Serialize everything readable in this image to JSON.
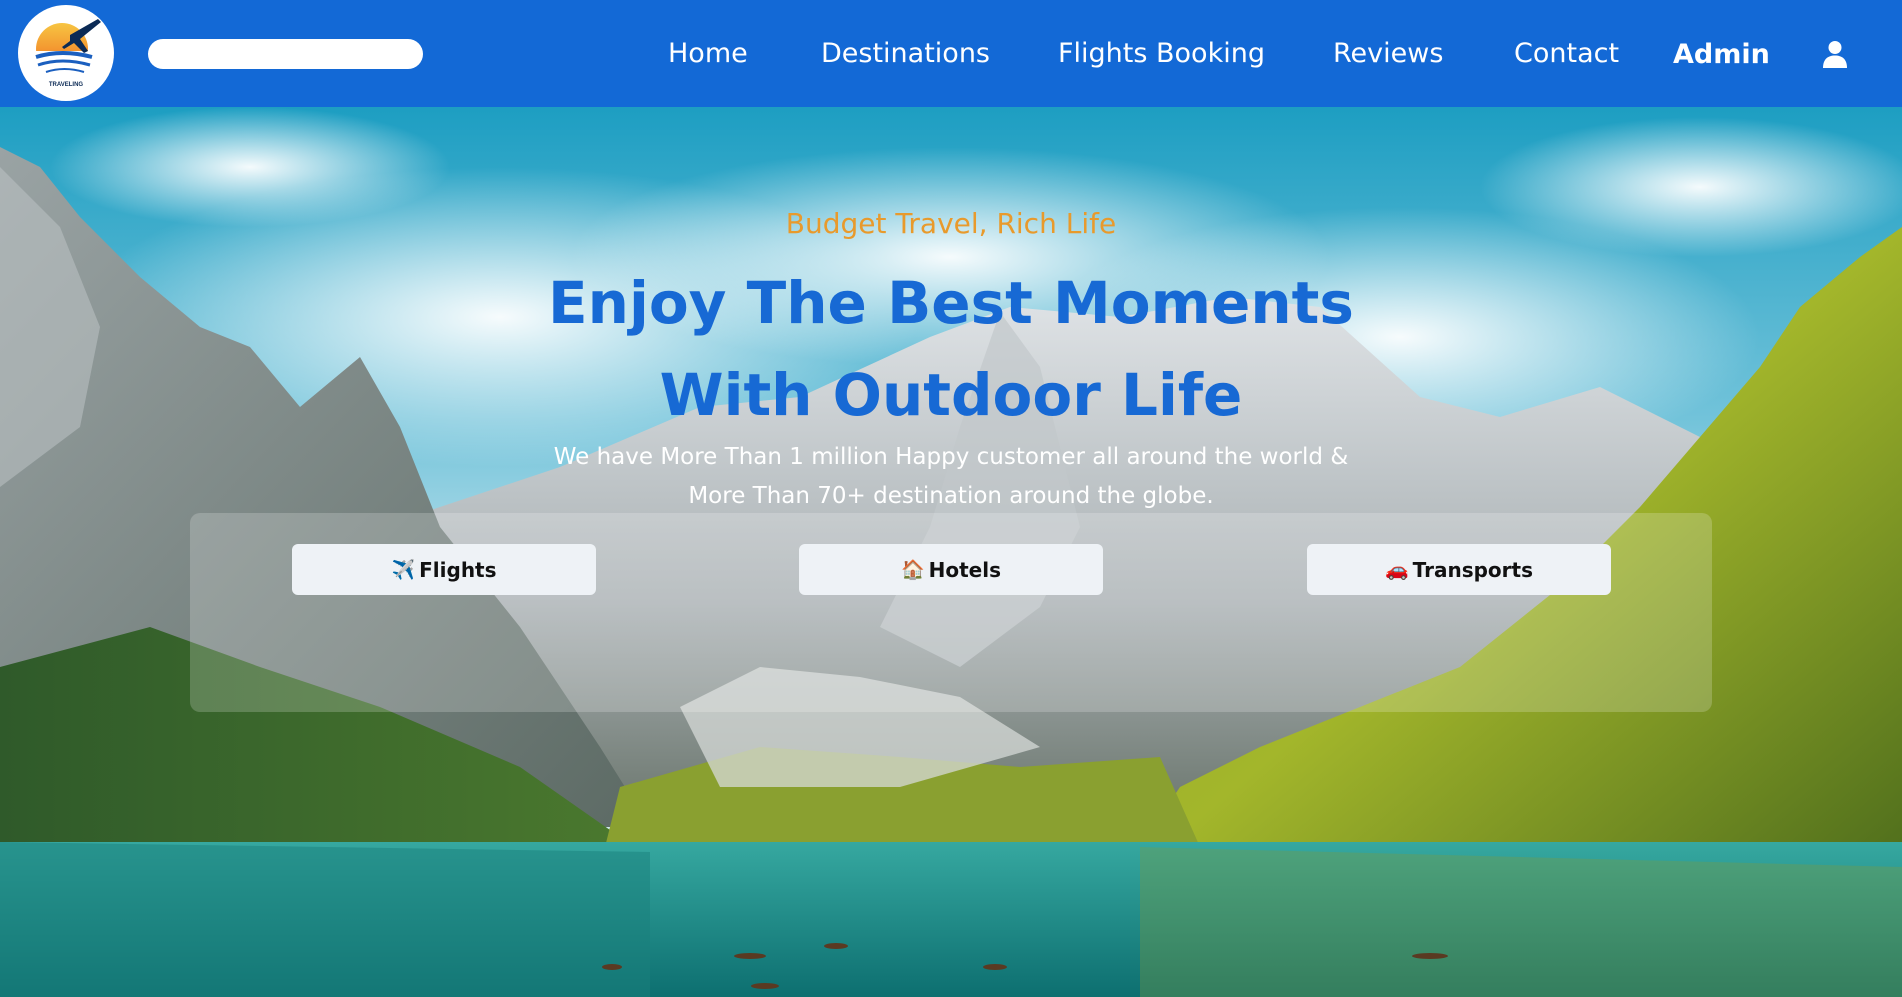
{
  "header": {
    "logo_text": "TRAVELING",
    "search": {
      "value": "",
      "placeholder": ""
    },
    "nav": [
      {
        "label": "Home"
      },
      {
        "label": "Destinations"
      },
      {
        "label": "Flights Booking"
      },
      {
        "label": "Reviews"
      },
      {
        "label": "Contact"
      }
    ],
    "admin_label": "Admin",
    "user_icon": "user-icon"
  },
  "hero": {
    "tagline": "Budget Travel, Rich Life",
    "headline_line1": "Enjoy The Best Moments",
    "headline_line2": "With Outdoor Life",
    "subtext_line1": "We have More Than 1 million Happy customer all around the world &",
    "subtext_line2": "More Than 70+ destination around the globe.",
    "buttons": [
      {
        "icon": "✈️",
        "label": "Flights",
        "icon_name": "airplane-icon"
      },
      {
        "icon": "🏠",
        "label": "Hotels",
        "icon_name": "house-icon"
      },
      {
        "icon": "🚗",
        "label": "Transports",
        "icon_name": "car-icon"
      }
    ]
  },
  "colors": {
    "header_bg": "#1369d6",
    "tagline": "#e89a2c",
    "headline": "#1769d4",
    "button_bg": "#eef2f6"
  }
}
